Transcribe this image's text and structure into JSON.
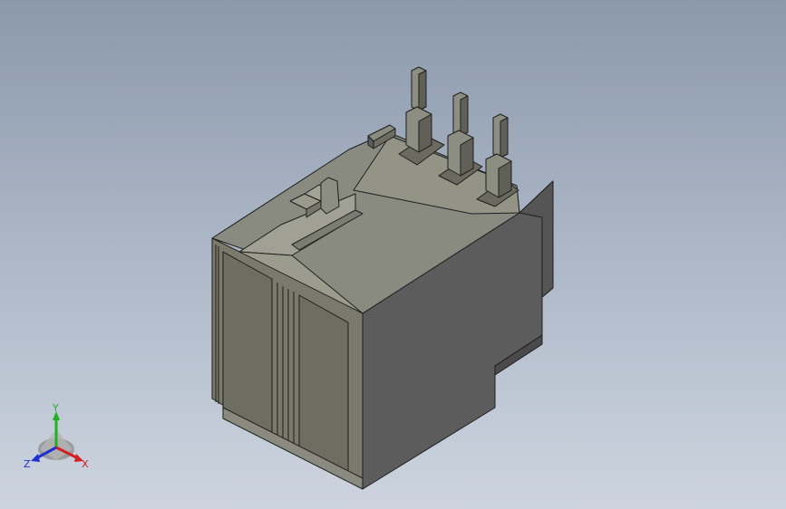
{
  "viewport": {
    "background_top": "#8c99ab",
    "background_bottom": "#cdd4df"
  },
  "model": {
    "face_colors": {
      "top": "#8a8b80",
      "top_light": "#a0a194",
      "front": "#7a7a6c",
      "front_dark": "#6c6c60",
      "side": "#5c5c5c",
      "side_dark": "#4f4f4f",
      "edge": "#1e1e1e"
    }
  },
  "triad": {
    "x_label": "X",
    "y_label": "Y",
    "z_label": "Z",
    "x_color": "#d42020",
    "y_color": "#20b020",
    "z_color": "#2030d0"
  }
}
